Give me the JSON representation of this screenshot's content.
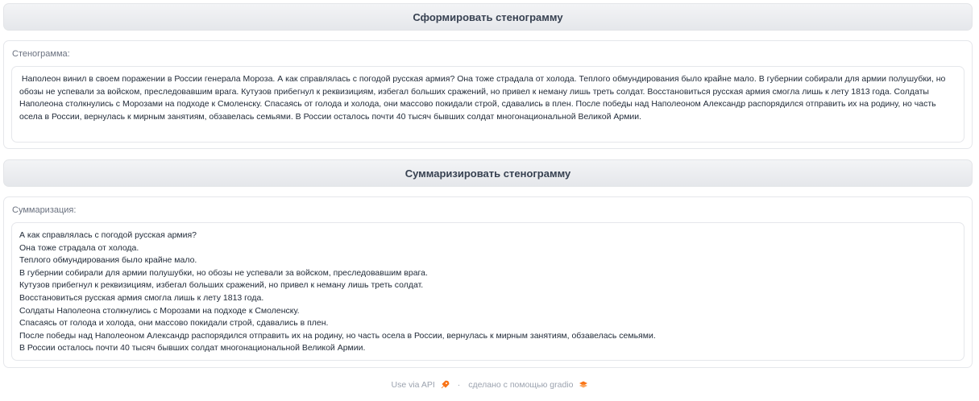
{
  "buttons": {
    "form_label": "Сформировать стенограмму",
    "summarize_label": "Суммаризировать стенограмму"
  },
  "transcript": {
    "label": "Стенограмма:",
    "text": " Наполеон винил в своем поражении в России генерала Мороза. А как справлялась с погодой русская армия? Она тоже страдала от холода. Теплого обмундирования было крайне мало. В губернии собирали для армии полушубки, но обозы не успевали за войском, преследовавшим врага. Кутузов прибегнул к реквизициям, избегал больших сражений, но привел к неману лишь треть солдат. Восстановиться русская армия смогла лишь к лету 1813 года. Солдаты Наполеона столкнулись с Морозами на подходе к Смоленску. Спасаясь от голода и холода, они массово покидали строй, сдавались в плен. После победы над Наполеоном Александр распорядился отправить их на родину, но часть осела в России, вернулась к мирным занятиям, обзавелась семьями. В России осталось почти 40 тысяч бывших солдат многонациональной Великой Армии."
  },
  "summary": {
    "label": "Суммаризация:",
    "text": "А как справлялась с погодой русская армия?\nОна тоже страдала от холода.\nТеплого обмундирования было крайне мало.\nВ губернии собирали для армии полушубки, но обозы не успевали за войском, преследовавшим врага.\nКутузов прибегнул к реквизициям, избегал больших сражений, но привел к неману лишь треть солдат.\nВосстановиться русская армия смогла лишь к лету 1813 года.\nСолдаты Наполеона столкнулись с Морозами на подходе к Смоленску.\nСпасаясь от голода и холода, они массово покидали строй, сдавались в плен.\nПосле победы над Наполеоном Александр распорядился отправить их на родину, но часть осела в России, вернулась к мирным занятиям, обзавелась семьями.\nВ России осталось почти 40 тысяч бывших солдат многонациональной Великой Армии."
  },
  "footer": {
    "api_label": "Use via API",
    "separator": "·",
    "made_with": "сделано с помощью gradio",
    "rocket_icon": "rocket-icon",
    "logo_icon": "gradio-logo-icon"
  }
}
